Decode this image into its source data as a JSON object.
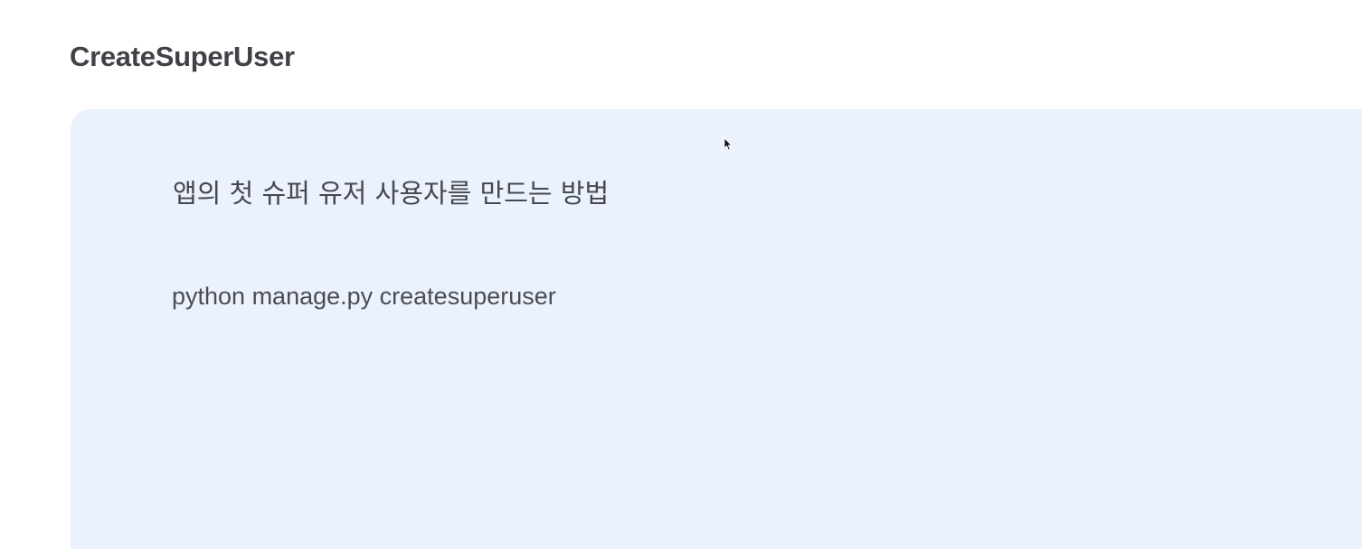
{
  "page": {
    "title": "CreateSuperUser"
  },
  "callout": {
    "heading": "앱의 첫 슈퍼 유저 사용자를 만드는 방법",
    "command": "python manage.py createsuperuser"
  },
  "colors": {
    "callout_background": "#ebf2fd",
    "title_text": "#3f4247",
    "body_text": "#45484d"
  },
  "icons": {
    "cursor": "mouse-pointer-icon"
  }
}
